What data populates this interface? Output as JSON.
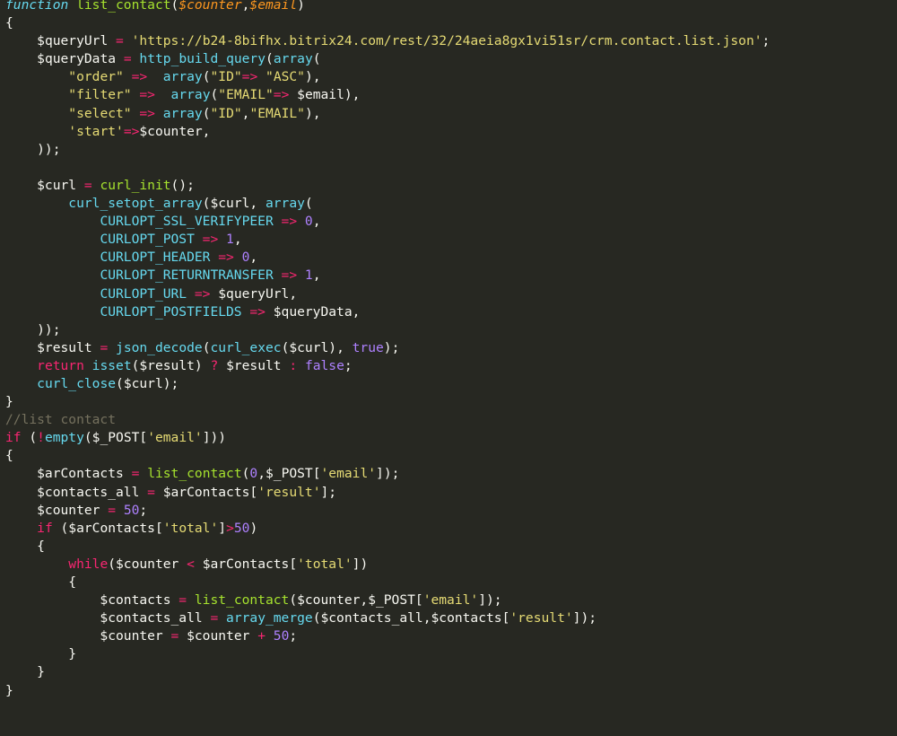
{
  "editor": {
    "theme": {
      "background": "#272822",
      "keyword": "#66d9ef",
      "function": "#a6e22e",
      "parameter": "#fd971f",
      "operator": "#f92672",
      "string": "#e6db74",
      "number": "#ae81ff",
      "comment": "#75715e",
      "text": "#f8f8f2"
    },
    "lines": [
      [
        [
          "kw",
          "function"
        ],
        [
          "text",
          " "
        ],
        [
          "fn",
          "list_contact"
        ],
        [
          "text",
          "("
        ],
        [
          "param",
          "$counter"
        ],
        [
          "text",
          ","
        ],
        [
          "param",
          "$email"
        ],
        [
          "text",
          ")"
        ]
      ],
      [
        [
          "text",
          "{"
        ]
      ],
      [
        [
          "text",
          "    "
        ],
        [
          "var",
          "$queryUrl"
        ],
        [
          "text",
          " "
        ],
        [
          "op",
          "="
        ],
        [
          "text",
          " "
        ],
        [
          "str",
          "'https://b24-8bifhx.bitrix24.com/rest/32/24aeia8gx1vi51sr/crm.contact.list.json'"
        ],
        [
          "text",
          ";"
        ]
      ],
      [
        [
          "text",
          "    "
        ],
        [
          "var",
          "$queryData"
        ],
        [
          "text",
          " "
        ],
        [
          "op",
          "="
        ],
        [
          "text",
          " "
        ],
        [
          "builtin",
          "http_build_query"
        ],
        [
          "text",
          "("
        ],
        [
          "builtin",
          "array"
        ],
        [
          "text",
          "("
        ]
      ],
      [
        [
          "text",
          "        "
        ],
        [
          "str",
          "\"order\""
        ],
        [
          "text",
          " "
        ],
        [
          "op",
          "=>"
        ],
        [
          "text",
          "  "
        ],
        [
          "builtin",
          "array"
        ],
        [
          "text",
          "("
        ],
        [
          "str",
          "\"ID\""
        ],
        [
          "op",
          "=>"
        ],
        [
          "text",
          " "
        ],
        [
          "str",
          "\"ASC\""
        ],
        [
          "text",
          "),"
        ]
      ],
      [
        [
          "text",
          "        "
        ],
        [
          "str",
          "\"filter\""
        ],
        [
          "text",
          " "
        ],
        [
          "op",
          "=>"
        ],
        [
          "text",
          "  "
        ],
        [
          "builtin",
          "array"
        ],
        [
          "text",
          "("
        ],
        [
          "str",
          "\"EMAIL\""
        ],
        [
          "op",
          "=>"
        ],
        [
          "text",
          " $email),"
        ]
      ],
      [
        [
          "text",
          "        "
        ],
        [
          "str",
          "\"select\""
        ],
        [
          "text",
          " "
        ],
        [
          "op",
          "=>"
        ],
        [
          "text",
          " "
        ],
        [
          "builtin",
          "array"
        ],
        [
          "text",
          "("
        ],
        [
          "str",
          "\"ID\""
        ],
        [
          "text",
          ","
        ],
        [
          "str",
          "\"EMAIL\""
        ],
        [
          "text",
          "),"
        ]
      ],
      [
        [
          "text",
          "        "
        ],
        [
          "str",
          "'start'"
        ],
        [
          "op",
          "=>"
        ],
        [
          "text",
          "$counter,"
        ]
      ],
      [
        [
          "text",
          "    ));"
        ]
      ],
      [
        [
          "text",
          ""
        ]
      ],
      [
        [
          "text",
          "    $curl "
        ],
        [
          "op",
          "="
        ],
        [
          "text",
          " "
        ],
        [
          "fn",
          "curl_init"
        ],
        [
          "text",
          "();"
        ]
      ],
      [
        [
          "text",
          "        "
        ],
        [
          "builtin",
          "curl_setopt_array"
        ],
        [
          "text",
          "($curl, "
        ],
        [
          "builtin",
          "array"
        ],
        [
          "text",
          "("
        ]
      ],
      [
        [
          "text",
          "            "
        ],
        [
          "const",
          "CURLOPT_SSL_VERIFYPEER"
        ],
        [
          "text",
          " "
        ],
        [
          "op",
          "=>"
        ],
        [
          "text",
          " "
        ],
        [
          "num",
          "0"
        ],
        [
          "text",
          ","
        ]
      ],
      [
        [
          "text",
          "            "
        ],
        [
          "const",
          "CURLOPT_POST"
        ],
        [
          "text",
          " "
        ],
        [
          "op",
          "=>"
        ],
        [
          "text",
          " "
        ],
        [
          "num",
          "1"
        ],
        [
          "text",
          ","
        ]
      ],
      [
        [
          "text",
          "            "
        ],
        [
          "const",
          "CURLOPT_HEADER"
        ],
        [
          "text",
          " "
        ],
        [
          "op",
          "=>"
        ],
        [
          "text",
          " "
        ],
        [
          "num",
          "0"
        ],
        [
          "text",
          ","
        ]
      ],
      [
        [
          "text",
          "            "
        ],
        [
          "const",
          "CURLOPT_RETURNTRANSFER"
        ],
        [
          "text",
          " "
        ],
        [
          "op",
          "=>"
        ],
        [
          "text",
          " "
        ],
        [
          "num",
          "1"
        ],
        [
          "text",
          ","
        ]
      ],
      [
        [
          "text",
          "            "
        ],
        [
          "const",
          "CURLOPT_URL"
        ],
        [
          "text",
          " "
        ],
        [
          "op",
          "=>"
        ],
        [
          "text",
          " $queryUrl,"
        ]
      ],
      [
        [
          "text",
          "            "
        ],
        [
          "const",
          "CURLOPT_POSTFIELDS"
        ],
        [
          "text",
          " "
        ],
        [
          "op",
          "=>"
        ],
        [
          "text",
          " $queryData,"
        ]
      ],
      [
        [
          "text",
          "    ));"
        ]
      ],
      [
        [
          "text",
          "    $result "
        ],
        [
          "op",
          "="
        ],
        [
          "text",
          " "
        ],
        [
          "builtin",
          "json_decode"
        ],
        [
          "text",
          "("
        ],
        [
          "builtin",
          "curl_exec"
        ],
        [
          "text",
          "($curl), "
        ],
        [
          "bool",
          "true"
        ],
        [
          "text",
          ");"
        ]
      ],
      [
        [
          "text",
          "    "
        ],
        [
          "ctrl",
          "return"
        ],
        [
          "text",
          " "
        ],
        [
          "builtin",
          "isset"
        ],
        [
          "text",
          "($result) "
        ],
        [
          "op",
          "?"
        ],
        [
          "text",
          " $result "
        ],
        [
          "op",
          ":"
        ],
        [
          "text",
          " "
        ],
        [
          "bool",
          "false"
        ],
        [
          "text",
          ";"
        ]
      ],
      [
        [
          "text",
          "    "
        ],
        [
          "builtin",
          "curl_close"
        ],
        [
          "text",
          "($curl);"
        ]
      ],
      [
        [
          "text",
          "}"
        ]
      ],
      [
        [
          "comment",
          "//list contact"
        ]
      ],
      [
        [
          "ctrl",
          "if"
        ],
        [
          "text",
          " ("
        ],
        [
          "op",
          "!"
        ],
        [
          "builtin",
          "empty"
        ],
        [
          "text",
          "($_POST["
        ],
        [
          "str",
          "'email'"
        ],
        [
          "text",
          "]))"
        ]
      ],
      [
        [
          "text",
          "{"
        ]
      ],
      [
        [
          "text",
          "    $arContacts "
        ],
        [
          "op",
          "="
        ],
        [
          "text",
          " "
        ],
        [
          "fn",
          "list_contact"
        ],
        [
          "text",
          "("
        ],
        [
          "num",
          "0"
        ],
        [
          "text",
          ",$_POST["
        ],
        [
          "str",
          "'email'"
        ],
        [
          "text",
          "]);"
        ]
      ],
      [
        [
          "text",
          "    $contacts_all "
        ],
        [
          "op",
          "="
        ],
        [
          "text",
          " $arContacts["
        ],
        [
          "str",
          "'result'"
        ],
        [
          "text",
          "];"
        ]
      ],
      [
        [
          "text",
          "    $counter "
        ],
        [
          "op",
          "="
        ],
        [
          "text",
          " "
        ],
        [
          "num",
          "50"
        ],
        [
          "text",
          ";"
        ]
      ],
      [
        [
          "text",
          "    "
        ],
        [
          "ctrl",
          "if"
        ],
        [
          "text",
          " ($arContacts["
        ],
        [
          "str",
          "'total'"
        ],
        [
          "text",
          "]"
        ],
        [
          "op",
          ">"
        ],
        [
          "num",
          "50"
        ],
        [
          "text",
          ")"
        ]
      ],
      [
        [
          "text",
          "    {"
        ]
      ],
      [
        [
          "text",
          "        "
        ],
        [
          "ctrl",
          "while"
        ],
        [
          "text",
          "($counter "
        ],
        [
          "op",
          "<"
        ],
        [
          "text",
          " $arContacts["
        ],
        [
          "str",
          "'total'"
        ],
        [
          "text",
          "])"
        ]
      ],
      [
        [
          "text",
          "        {"
        ]
      ],
      [
        [
          "text",
          "            $contacts "
        ],
        [
          "op",
          "="
        ],
        [
          "text",
          " "
        ],
        [
          "fn",
          "list_contact"
        ],
        [
          "text",
          "($counter,$_POST["
        ],
        [
          "str",
          "'email'"
        ],
        [
          "text",
          "]);"
        ]
      ],
      [
        [
          "text",
          "            $contacts_all "
        ],
        [
          "op",
          "="
        ],
        [
          "text",
          " "
        ],
        [
          "builtin",
          "array_merge"
        ],
        [
          "text",
          "($contacts_all,$contacts["
        ],
        [
          "str",
          "'result'"
        ],
        [
          "text",
          "]);"
        ]
      ],
      [
        [
          "text",
          "            $counter "
        ],
        [
          "op",
          "="
        ],
        [
          "text",
          " $counter "
        ],
        [
          "op",
          "+"
        ],
        [
          "text",
          " "
        ],
        [
          "num",
          "50"
        ],
        [
          "text",
          ";"
        ]
      ],
      [
        [
          "text",
          "        }"
        ]
      ],
      [
        [
          "text",
          "    }"
        ]
      ],
      [
        [
          "text",
          "}"
        ]
      ]
    ]
  }
}
